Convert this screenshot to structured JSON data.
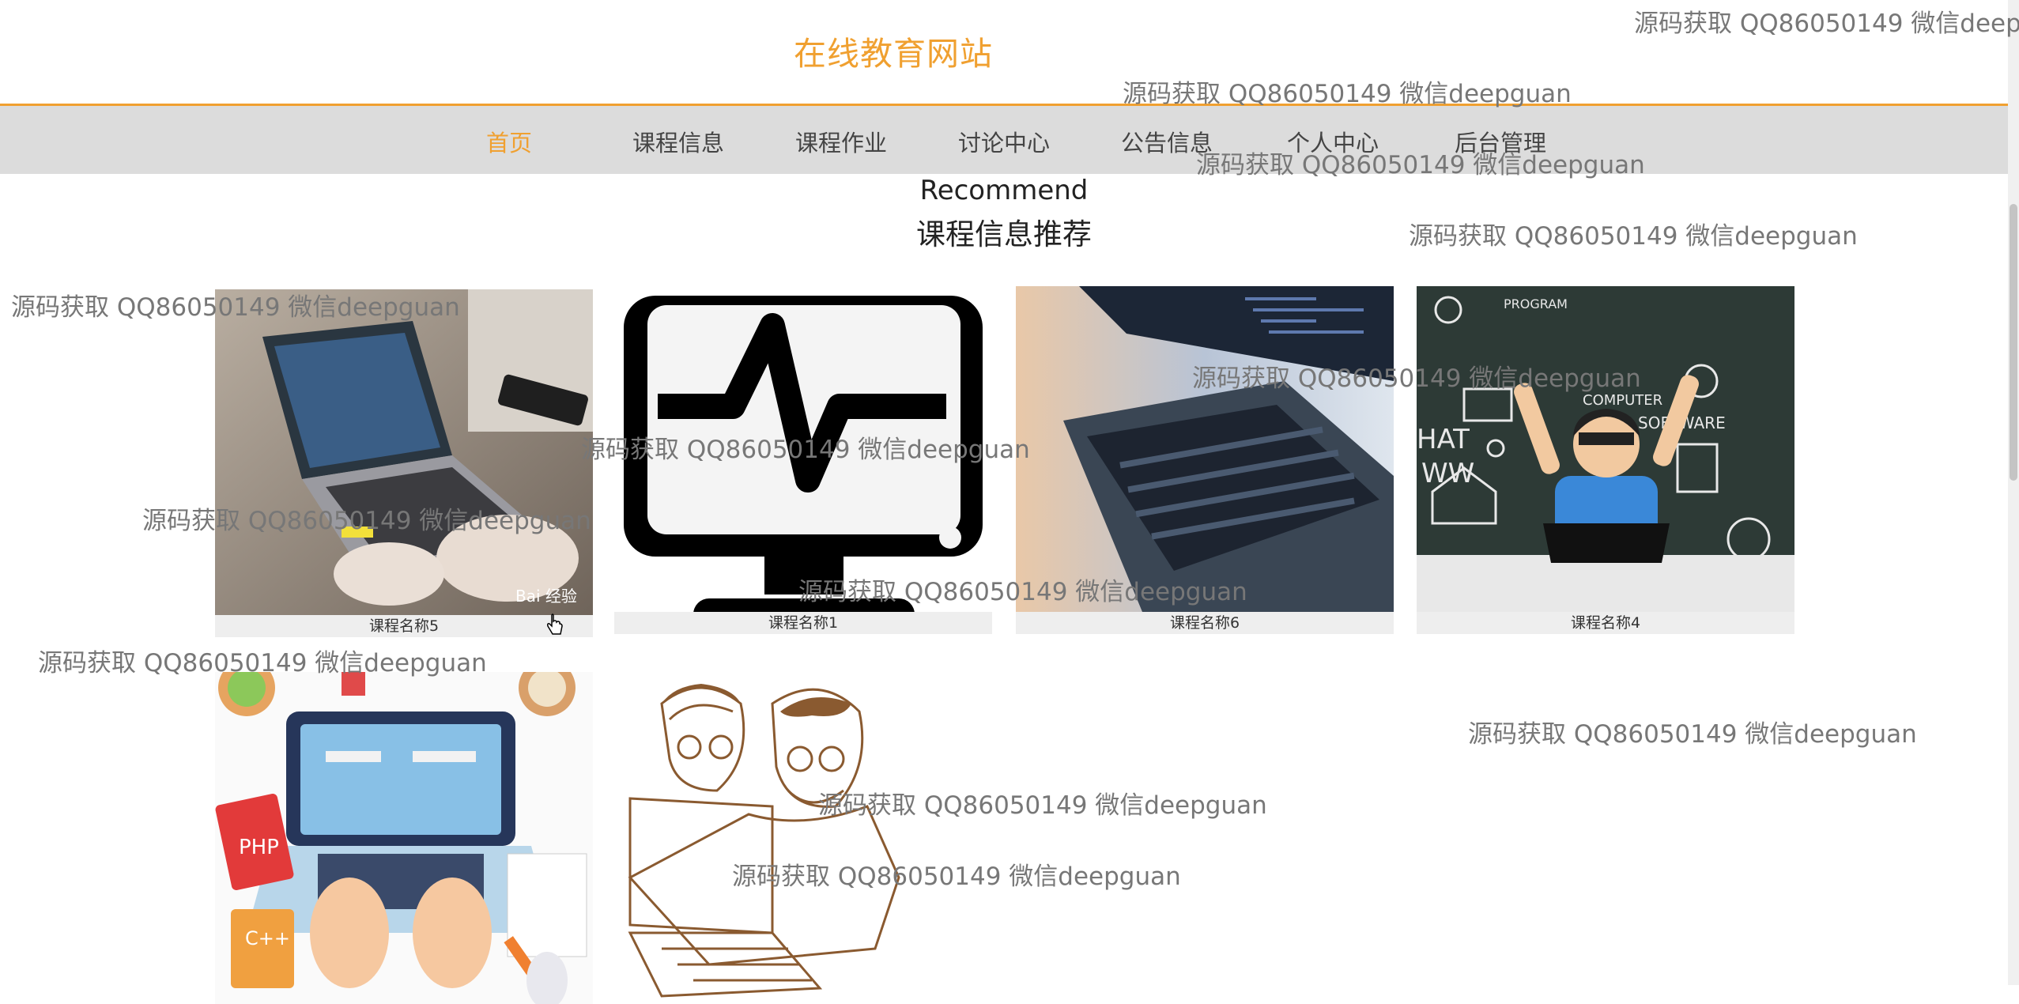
{
  "header": {
    "title": "在线教育网站"
  },
  "nav": {
    "items": [
      "首页",
      "课程信息",
      "课程作业",
      "讨论中心",
      "公告信息",
      "个人中心",
      "后台管理"
    ],
    "active": 0
  },
  "section": {
    "title_en": "Recommend",
    "title_cn": "课程信息推荐"
  },
  "cards": [
    {
      "name": "课程名称5",
      "image": "laptop-typing-photo"
    },
    {
      "name": "课程名称1",
      "image": "monitor-pulse-icon"
    },
    {
      "name": "课程名称6",
      "image": "laptop-code-photo"
    },
    {
      "name": "课程名称4",
      "image": "child-computer-chalkboard-photo"
    },
    {
      "name": "",
      "image": "coding-laptop-illustration"
    },
    {
      "name": "",
      "image": "sketch-people-laptop-illustration"
    }
  ],
  "watermark": {
    "text": "源码获取 QQ86050149 微信deepguan"
  },
  "colors": {
    "accent": "#f0a030",
    "nav_bg": "#dcdcdc",
    "caption_bg": "#eeeeee"
  }
}
